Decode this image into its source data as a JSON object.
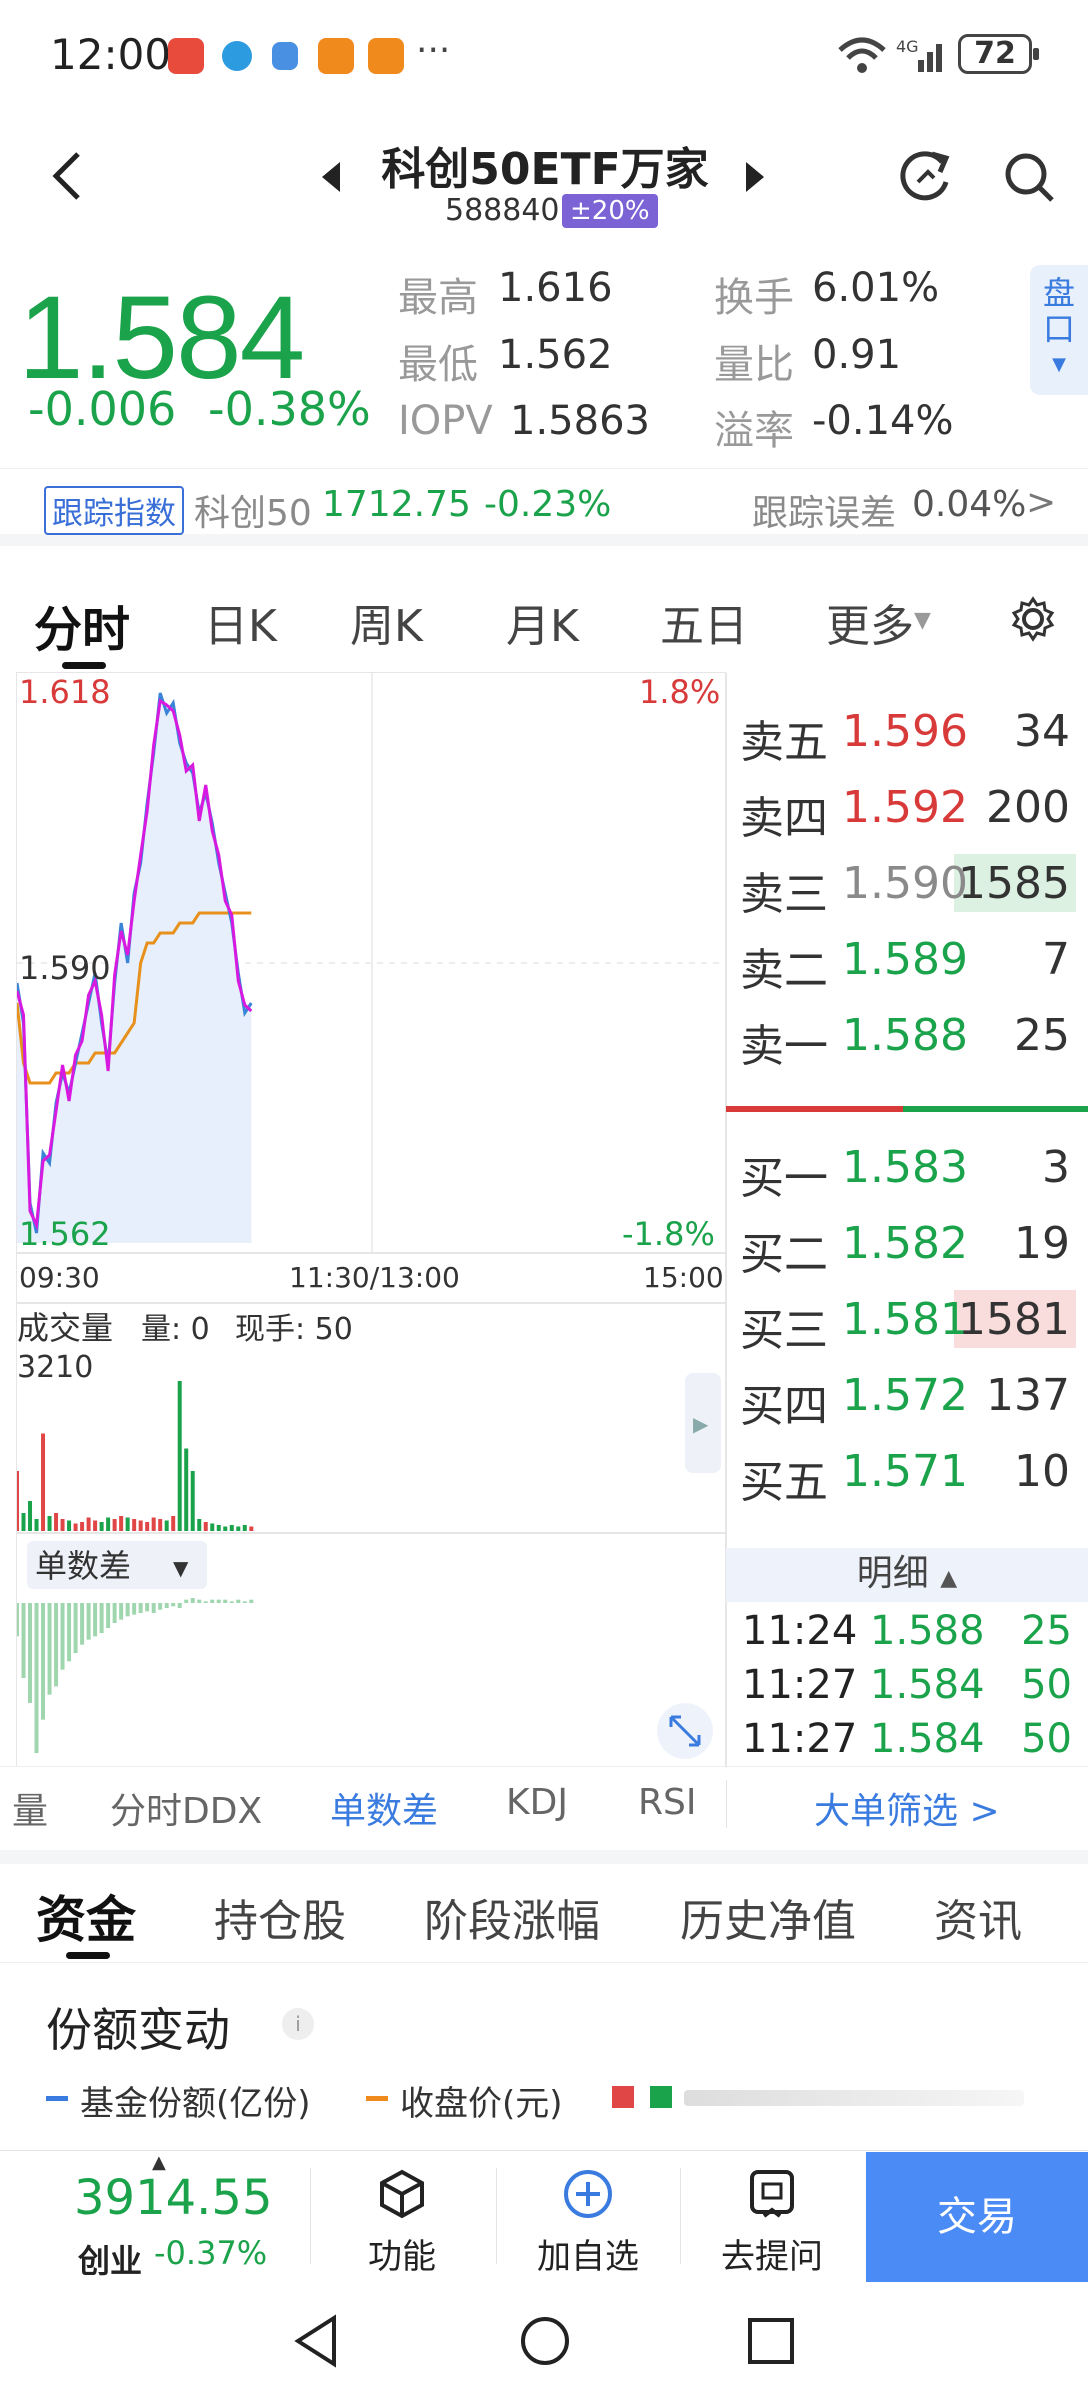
{
  "status": {
    "time": "12:00",
    "battery": "72",
    "ellipsis": "···"
  },
  "header": {
    "title": "科创50ETF万家",
    "code": "588840",
    "limit_badge": "±20%"
  },
  "quote": {
    "price": "1.584",
    "change": "-0.006",
    "change_pct": "-0.38%",
    "stats": [
      {
        "label": "最高",
        "value": "1.616"
      },
      {
        "label": "最低",
        "value": "1.562"
      },
      {
        "label": "IOPV",
        "value": "1.5863"
      },
      {
        "label": "换手",
        "value": "6.01%"
      },
      {
        "label": "量比",
        "value": "0.91"
      },
      {
        "label": "溢率",
        "value": "-0.14%"
      }
    ],
    "pankou": "盘口"
  },
  "tracking": {
    "tag": "跟踪指数",
    "index_name": "科创50",
    "index_value": "1712.75",
    "index_change": "-0.23%",
    "error_label": "跟踪误差",
    "error_value": "0.04%"
  },
  "chart_tabs": [
    "分时",
    "日K",
    "周K",
    "月K",
    "五日",
    "更多"
  ],
  "chart_labels": {
    "top_price": "1.618",
    "mid_price": "1.590",
    "bottom_price": "1.562",
    "top_pct": "1.8%",
    "bottom_pct": "-1.8%",
    "time_start": "09:30",
    "time_mid": "11:30/13:00",
    "time_end": "15:00",
    "volume_label": "成交量",
    "volume_qty": "量: 0",
    "volume_hand": "现手: 50",
    "volume_max": "3210",
    "diff_label": "单数差"
  },
  "chart_data": {
    "type": "line",
    "x_range": [
      "09:30",
      "11:30"
    ],
    "ylim": [
      1.562,
      1.618
    ],
    "series": [],
    "price": [
      1.588,
      1.584,
      1.566,
      1.563,
      1.571,
      1.57,
      1.576,
      1.579,
      1.577,
      1.58,
      1.583,
      1.586,
      1.589,
      1.584,
      1.58,
      1.588,
      1.594,
      1.59,
      1.597,
      1.6,
      1.606,
      1.611,
      1.617,
      1.615,
      1.616,
      1.612,
      1.61,
      1.609,
      1.605,
      1.607,
      1.604,
      1.6,
      1.597,
      1.594,
      1.589,
      1.585,
      1.586
    ],
    "avg": [
      1.586,
      1.58,
      1.578,
      1.578,
      1.578,
      1.578,
      1.579,
      1.579,
      1.579,
      1.58,
      1.58,
      1.58,
      1.581,
      1.581,
      1.581,
      1.581,
      1.582,
      1.583,
      1.584,
      1.59,
      1.592,
      1.592,
      1.593,
      1.593,
      1.593,
      1.594,
      1.594,
      1.594,
      1.595,
      1.595,
      1.595,
      1.595,
      1.595,
      1.595,
      1.595,
      1.595,
      1.595
    ],
    "volume": [
      40,
      12,
      20,
      8,
      65,
      10,
      12,
      8,
      7,
      5,
      6,
      9,
      7,
      6,
      9,
      8,
      10,
      9,
      8,
      7,
      6,
      9,
      8,
      7,
      10,
      100,
      55,
      40,
      8,
      6,
      5,
      4,
      3,
      4,
      3,
      4,
      3
    ],
    "diff": [
      -20,
      -45,
      -60,
      -90,
      -70,
      -55,
      -50,
      -40,
      -35,
      -30,
      -25,
      -22,
      -20,
      -18,
      -15,
      -12,
      -10,
      -8,
      -7,
      -6,
      -5,
      -6,
      -4,
      -3,
      -2,
      -3,
      2,
      3,
      2,
      1,
      2,
      2,
      2,
      1,
      2,
      1,
      2
    ]
  },
  "orderbook": {
    "asks": [
      {
        "label": "卖五",
        "price": "1.596",
        "vol": "34",
        "price_color": "red"
      },
      {
        "label": "卖四",
        "price": "1.592",
        "vol": "200",
        "price_color": "red"
      },
      {
        "label": "卖三",
        "price": "1.590",
        "vol": "1585",
        "price_color": "gray"
      },
      {
        "label": "卖二",
        "price": "1.589",
        "vol": "7",
        "price_color": "green"
      },
      {
        "label": "卖一",
        "price": "1.588",
        "vol": "25",
        "price_color": "green"
      }
    ],
    "bids": [
      {
        "label": "买一",
        "price": "1.583",
        "vol": "3",
        "price_color": "green"
      },
      {
        "label": "买二",
        "price": "1.582",
        "vol": "19",
        "price_color": "green"
      },
      {
        "label": "买三",
        "price": "1.581",
        "vol": "1581",
        "price_color": "green"
      },
      {
        "label": "买四",
        "price": "1.572",
        "vol": "137",
        "price_color": "green"
      },
      {
        "label": "买五",
        "price": "1.571",
        "vol": "10",
        "price_color": "green"
      }
    ]
  },
  "details": {
    "header": "明细",
    "rows": [
      {
        "time": "11:24",
        "price": "1.588",
        "vol": "25"
      },
      {
        "time": "11:27",
        "price": "1.584",
        "vol": "50"
      },
      {
        "time": "11:27",
        "price": "1.584",
        "vol": "50"
      }
    ]
  },
  "indicator_tabs": [
    "量",
    "分时DDX",
    "单数差",
    "KDJ",
    "RSI"
  ],
  "big_order_filter": "大单筛选 >",
  "section_tabs": [
    "资金",
    "持仓股",
    "阶段涨幅",
    "历史净值",
    "资讯"
  ],
  "share_change": {
    "title": "份额变动",
    "legend_shares": "基金份额(亿份)",
    "legend_close": "收盘价(元)"
  },
  "bottom": {
    "index_value": "3914.55",
    "index_name": "创业",
    "index_change": "-0.37%",
    "func": "功能",
    "add": "加自选",
    "ask": "去提问",
    "trade": "交易"
  }
}
